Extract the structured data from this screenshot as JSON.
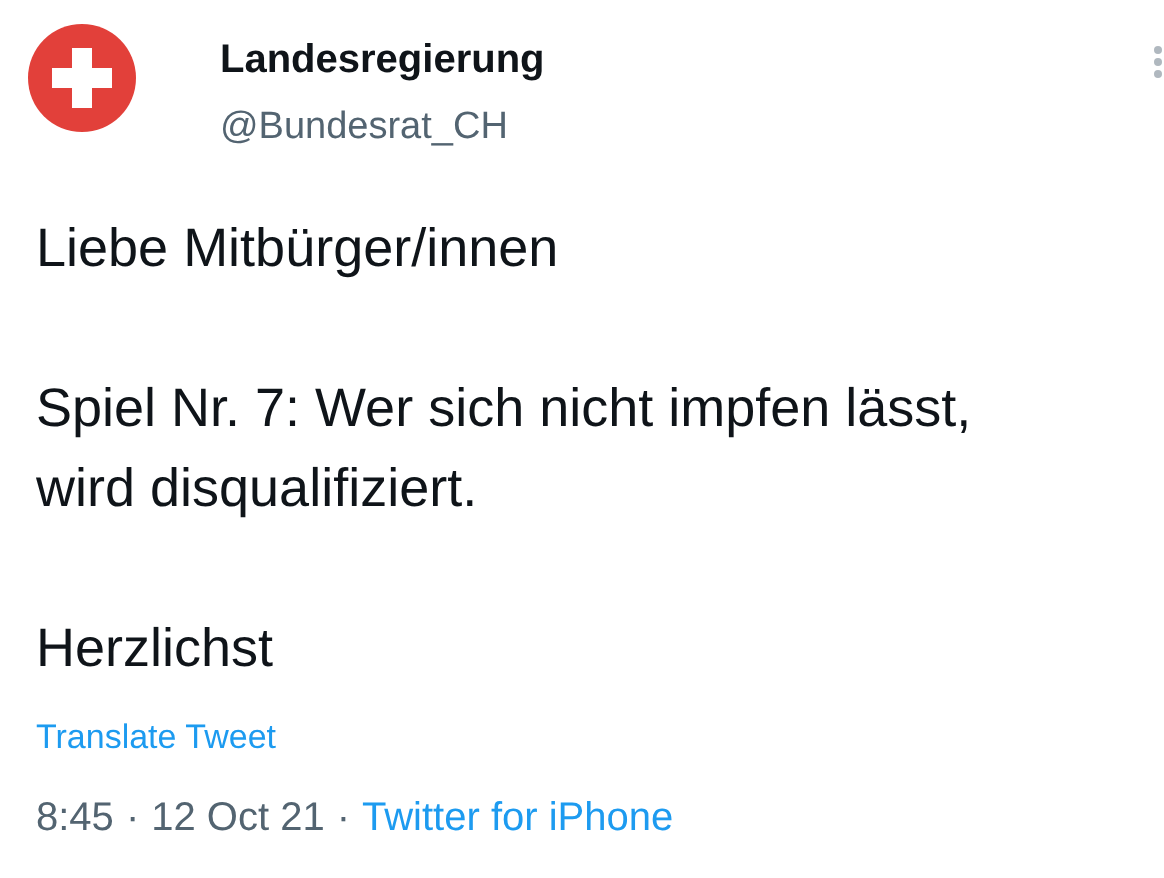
{
  "author": {
    "name": "Landesregierung",
    "handle": "@Bundesrat_CH"
  },
  "body": [
    "Liebe Mitbürger/innen",
    "Spiel Nr. 7: Wer sich nicht impfen lässt, wird disqualifiziert.",
    "Herzlichst"
  ],
  "translate_link": "Translate Tweet",
  "footer": {
    "time": "8:45",
    "separator": "·",
    "date": "12 Oct 21",
    "separator_2": "·",
    "source": "Twitter for iPhone"
  }
}
